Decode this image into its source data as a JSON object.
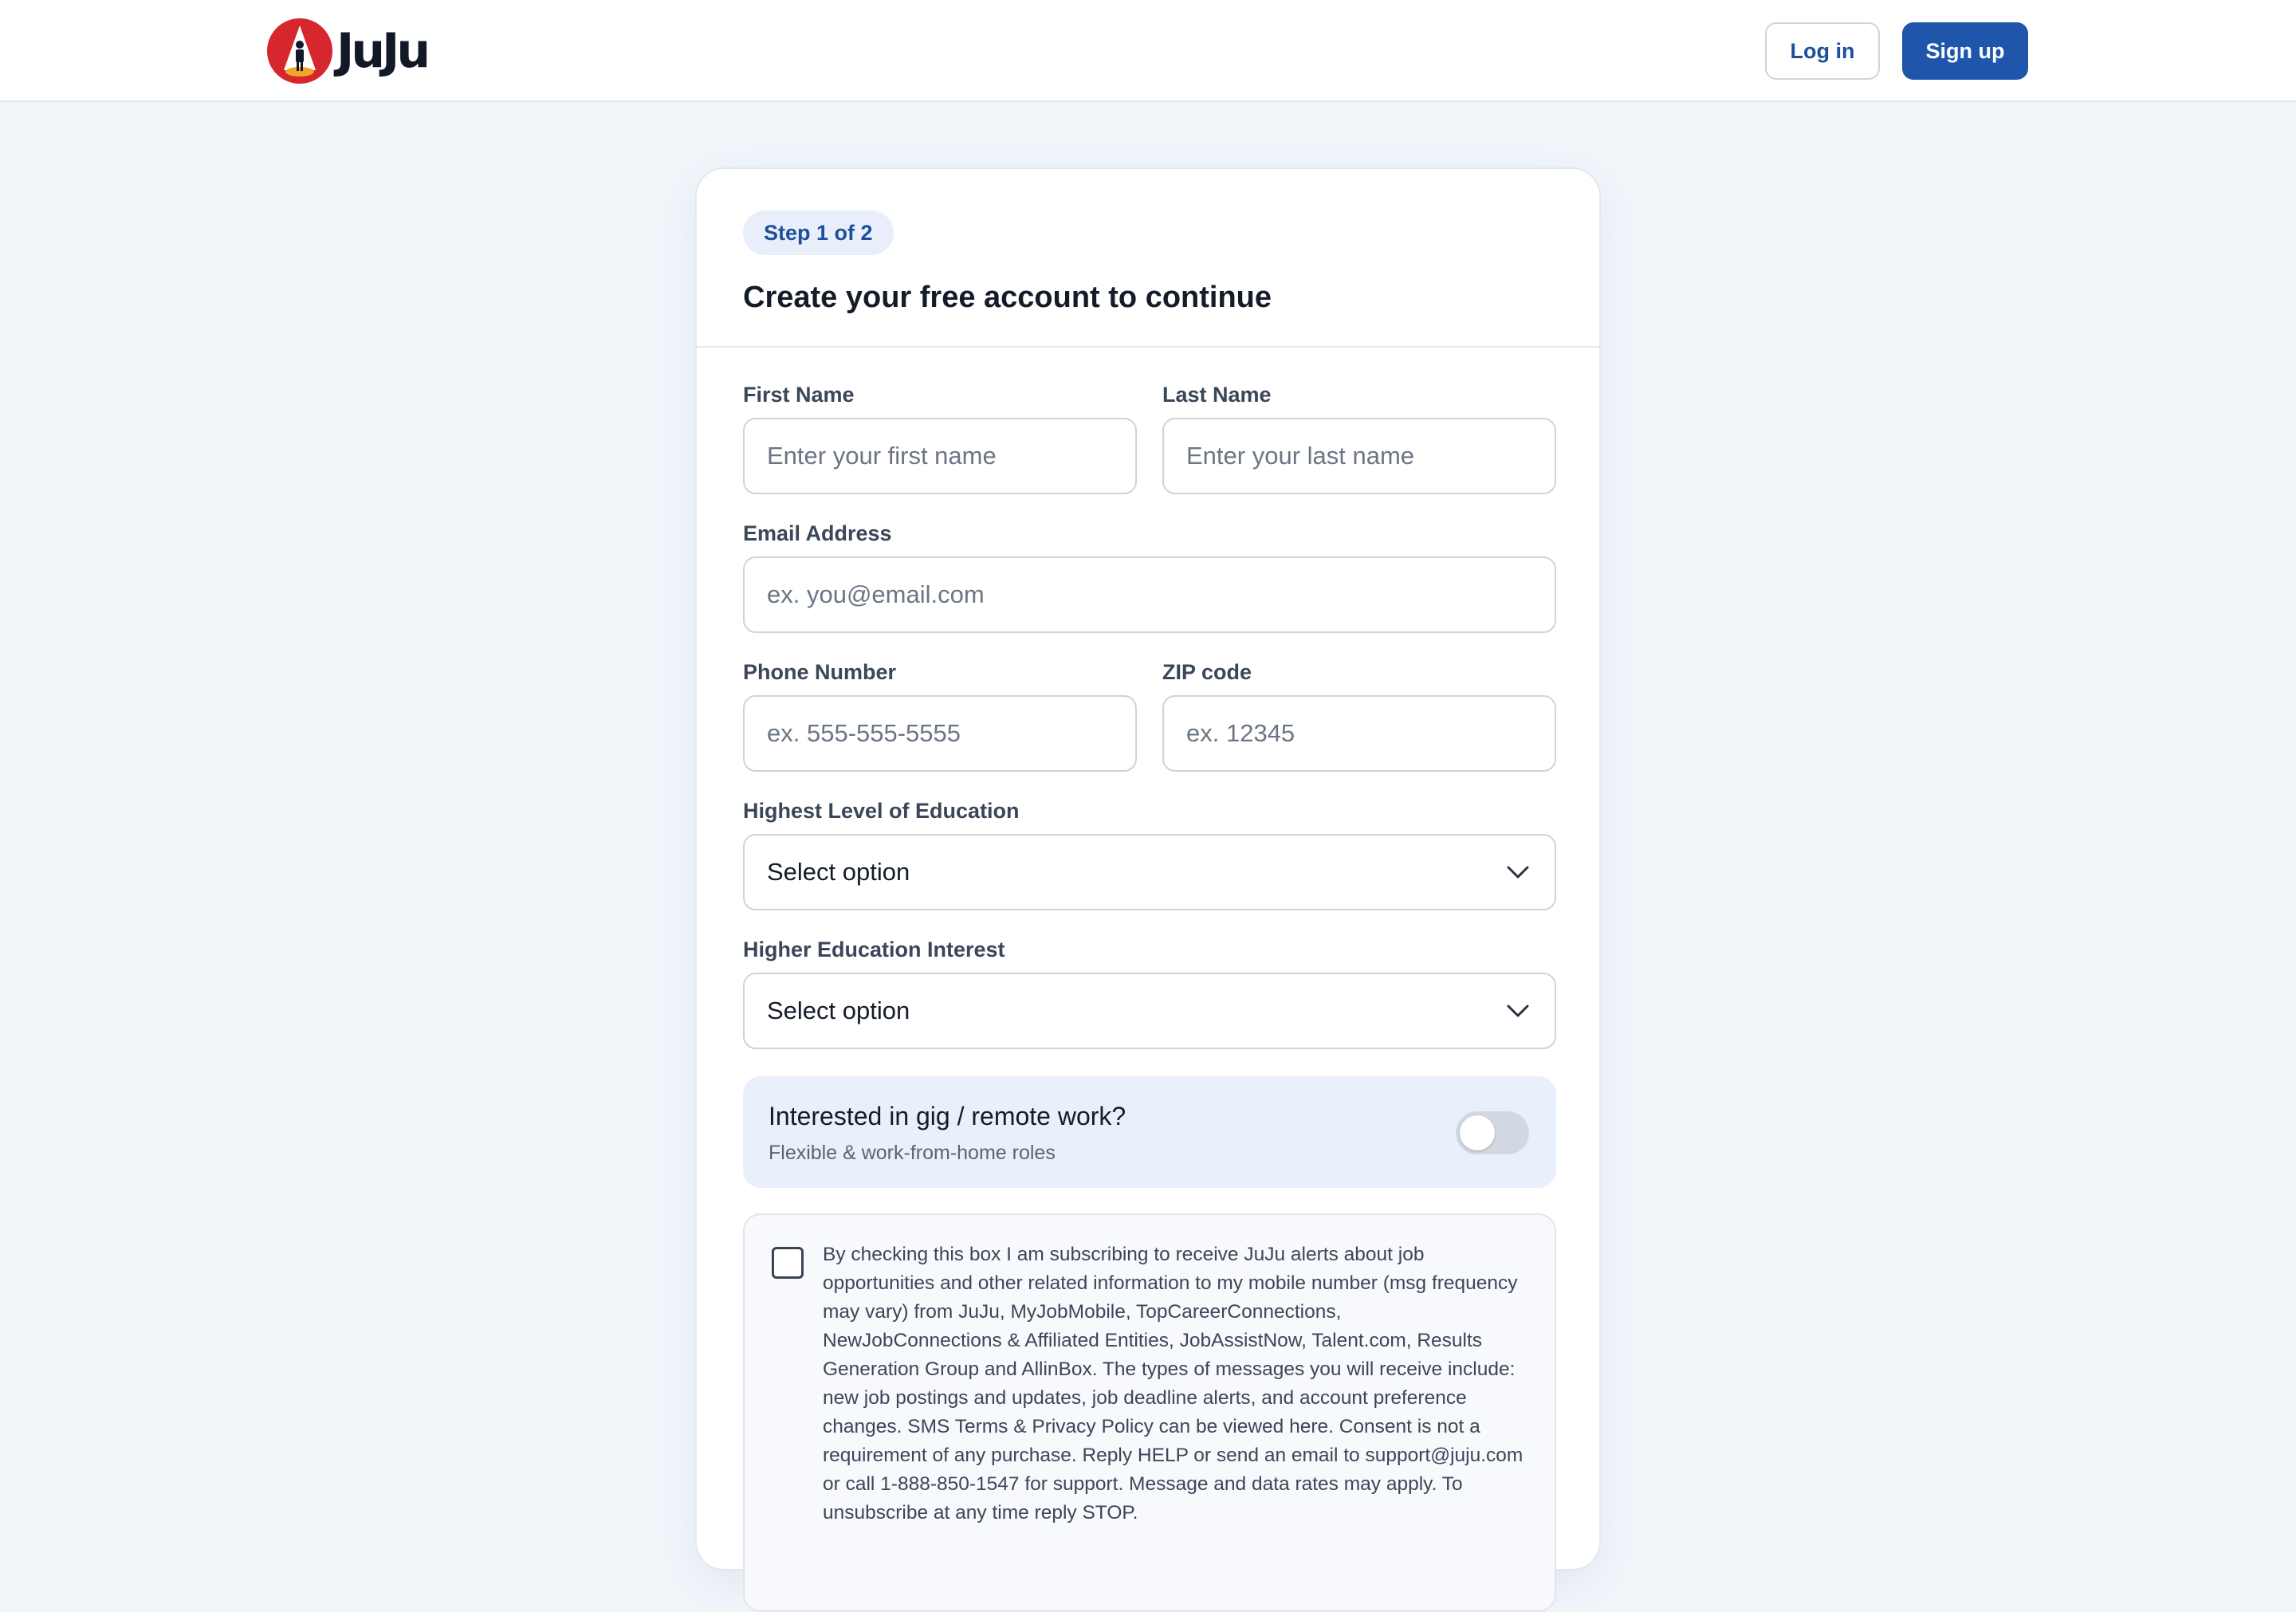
{
  "header": {
    "logo_text": "JuJu",
    "login_label": "Log in",
    "signup_label": "Sign up"
  },
  "form": {
    "step": "Step 1 of 2",
    "title": "Create your free account to continue",
    "first_name": {
      "label": "First Name",
      "placeholder": "Enter your first name"
    },
    "last_name": {
      "label": "Last Name",
      "placeholder": "Enter your last name"
    },
    "email": {
      "label": "Email Address",
      "placeholder": "ex. you@email.com"
    },
    "phone": {
      "label": "Phone Number",
      "placeholder": "ex. 555-555-5555"
    },
    "zip": {
      "label": "ZIP code",
      "placeholder": "ex. 12345"
    },
    "education": {
      "label": "Highest Level of Education",
      "value": "Select option"
    },
    "higher_ed": {
      "label": "Higher Education Interest",
      "value": "Select option"
    },
    "gig": {
      "title": "Interested in gig / remote work?",
      "subtitle": "Flexible & work-from-home roles",
      "enabled": false
    },
    "consent": {
      "checked": false,
      "text": "By checking this box I am subscribing to receive JuJu alerts about job opportunities and other related information to my mobile number (msg frequency may vary) from JuJu, MyJobMobile, TopCareerConnections, NewJobConnections & Affiliated Entities, JobAssistNow, Talent.com, Results Generation Group and AllinBox. The types of messages you will receive include: new job postings and updates, job deadline alerts, and account preference changes. SMS Terms & Privacy Policy can be viewed here. Consent is not a requirement of any purchase. Reply HELP or send an email to support@juju.com or call 1-888-850-1547 for support. Message and data rates may apply. To unsubscribe at any time reply STOP."
    }
  },
  "colors": {
    "primary": "#1f56ab",
    "page_bg": "#f2f6fb",
    "logo_red": "#d6262e"
  }
}
